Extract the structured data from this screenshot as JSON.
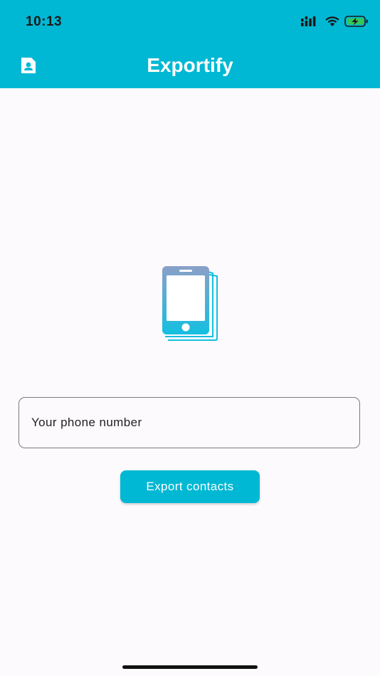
{
  "status_bar": {
    "time": "10:13",
    "icons": [
      "cellular-signal-icon",
      "wifi-icon",
      "battery-charging-icon"
    ]
  },
  "app_bar": {
    "title": "Exportify",
    "leading_icon": "contact-icon"
  },
  "main": {
    "illustration_icon": "phone-book-icon",
    "phone_input": {
      "placeholder": "Your phone number",
      "value": ""
    },
    "export_button_label": "Export contacts"
  },
  "colors": {
    "primary": "#00b8d4",
    "background": "#fdfafd",
    "icon_gradient_top": "#8aa0c8",
    "icon_gradient_bottom": "#14bfe0",
    "battery_green": "#34c759"
  }
}
